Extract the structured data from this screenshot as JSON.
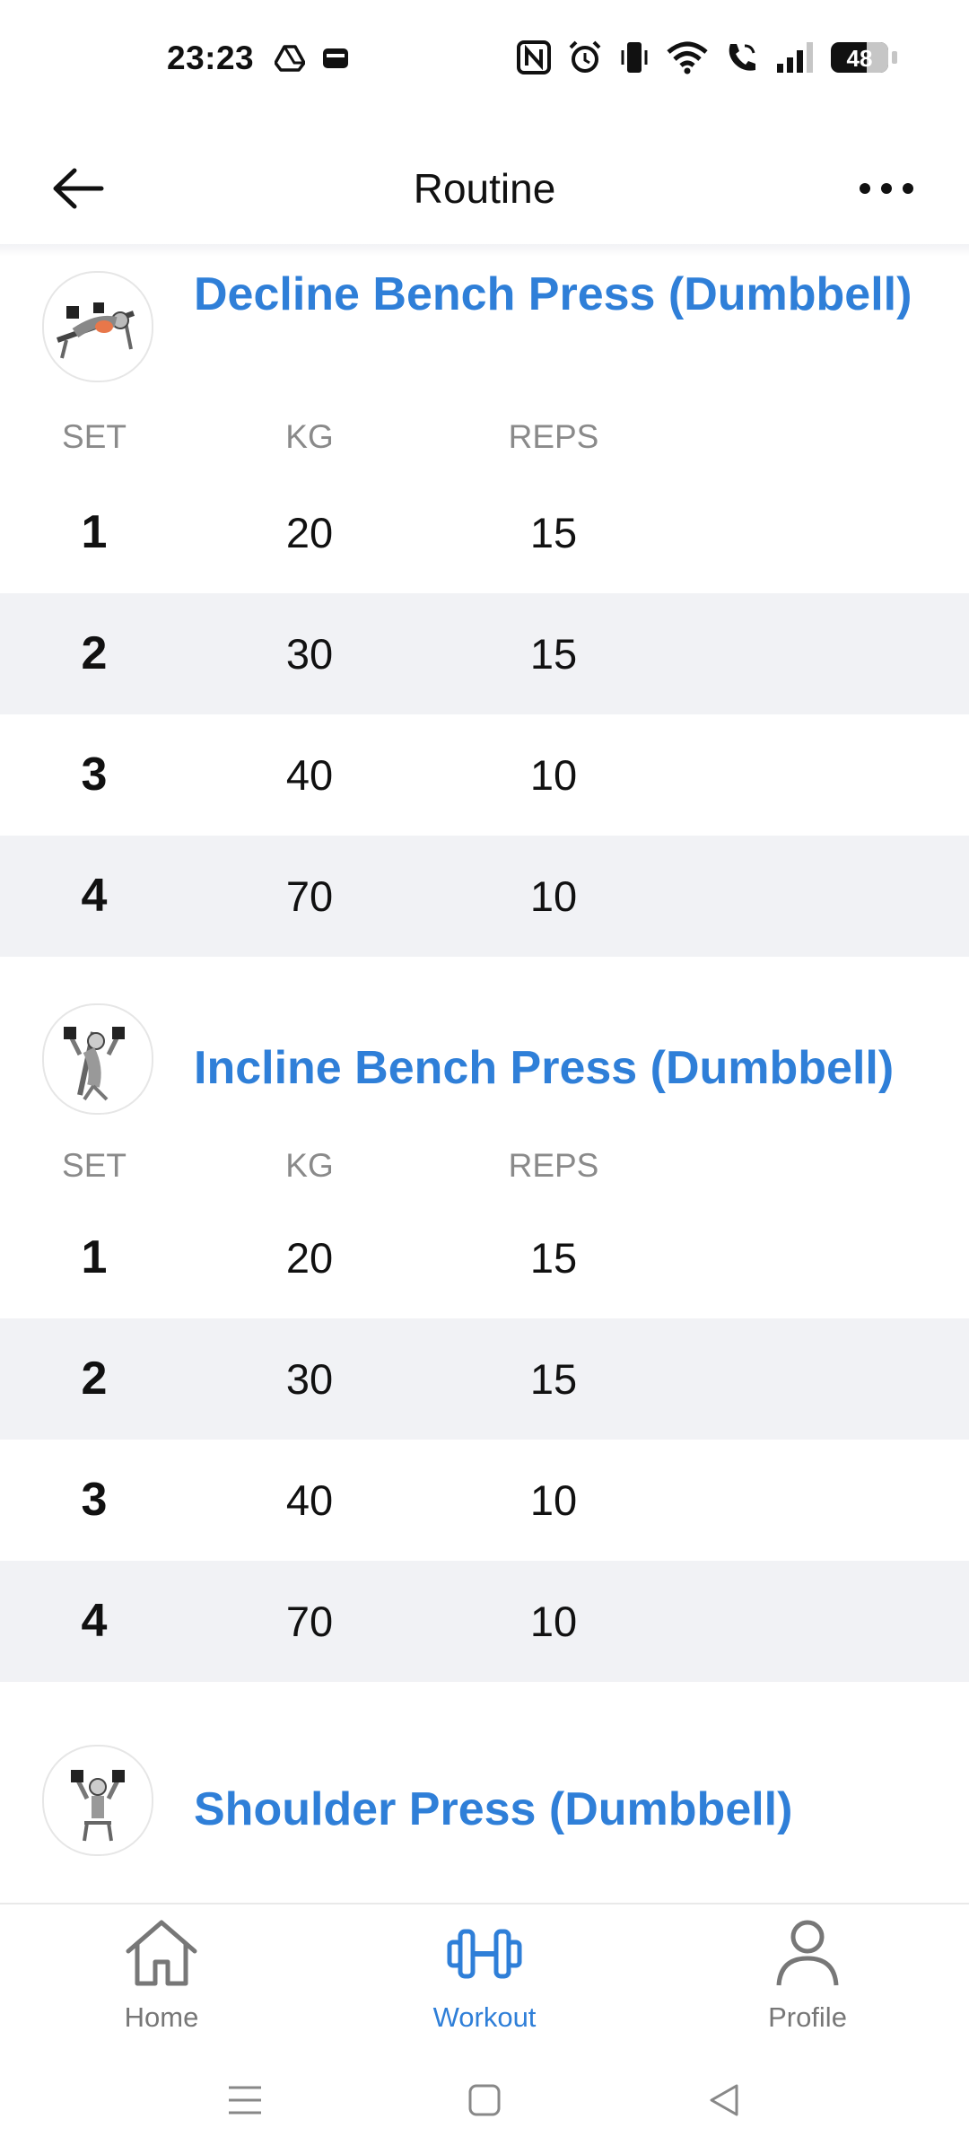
{
  "status_bar": {
    "time": "23:23",
    "battery_level": "48",
    "icons_left": [
      "drive-icon",
      "wallet-icon"
    ],
    "icons_right": [
      "nfc-icon",
      "alarm-icon",
      "vibrate-icon",
      "wifi-icon",
      "wifi-call-icon",
      "signal-icon",
      "battery-icon"
    ]
  },
  "header": {
    "title": "Routine",
    "back_icon": "arrow-left-icon",
    "more_icon": "more-horizontal-icon"
  },
  "columns": {
    "set": "SET",
    "kg": "KG",
    "reps": "REPS"
  },
  "exercises": [
    {
      "name": "Decline Bench Press (Dumbbell)",
      "sets": [
        {
          "set": "1",
          "kg": "20",
          "reps": "15"
        },
        {
          "set": "2",
          "kg": "30",
          "reps": "15"
        },
        {
          "set": "3",
          "kg": "40",
          "reps": "10"
        },
        {
          "set": "4",
          "kg": "70",
          "reps": "10"
        }
      ]
    },
    {
      "name": "Incline Bench Press (Dumbbell)",
      "sets": [
        {
          "set": "1",
          "kg": "20",
          "reps": "15"
        },
        {
          "set": "2",
          "kg": "30",
          "reps": "15"
        },
        {
          "set": "3",
          "kg": "40",
          "reps": "10"
        },
        {
          "set": "4",
          "kg": "70",
          "reps": "10"
        }
      ]
    },
    {
      "name": "Shoulder Press (Dumbbell)",
      "sets": []
    }
  ],
  "bottom_nav": {
    "items": [
      {
        "label": "Home",
        "icon": "home-icon",
        "active": false
      },
      {
        "label": "Workout",
        "icon": "dumbbell-icon",
        "active": true
      },
      {
        "label": "Profile",
        "icon": "person-icon",
        "active": false
      }
    ]
  },
  "colors": {
    "accent": "#2f7fd8",
    "row_alt": "#f1f2f5",
    "muted_text": "#8a8a8a"
  }
}
